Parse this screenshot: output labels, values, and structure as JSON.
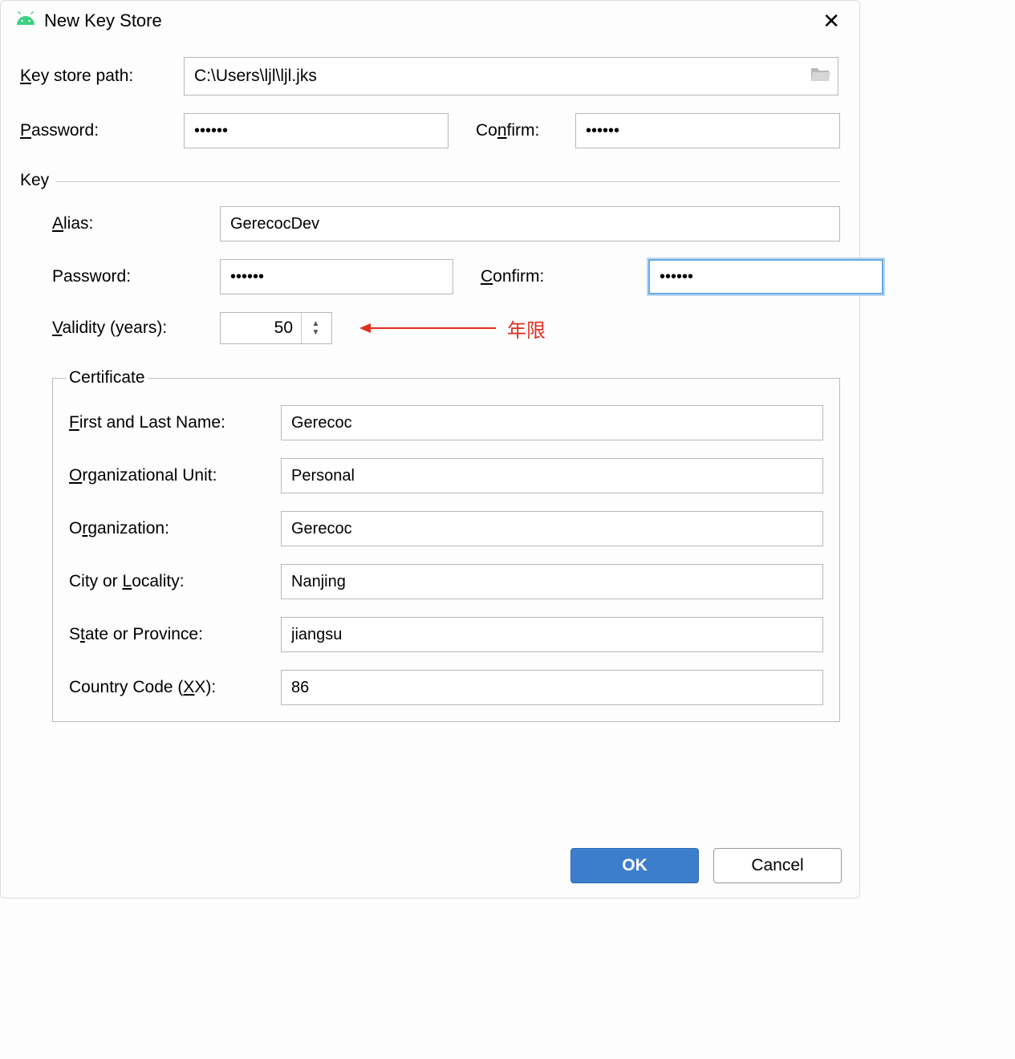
{
  "title": "New Key Store",
  "labels": {
    "keystore_path": "Key store path:",
    "password": "Password:",
    "confirm": "Confirm:",
    "key_section": "Key",
    "alias": "Alias:",
    "key_password": "Password:",
    "key_confirm": "Confirm:",
    "validity": "Validity (years):",
    "cert_legend": "Certificate",
    "first_last": "First and Last Name:",
    "org_unit": "Organizational Unit:",
    "org": "Organization:",
    "city": "City or Locality:",
    "state": "State or Province:",
    "country": "Country Code (XX):"
  },
  "values": {
    "keystore_path": "C:\\Users\\ljl\\ljl.jks",
    "password": "••••••",
    "confirm": "••••••",
    "alias": "GerecocDev",
    "key_password": "••••••",
    "key_confirm": "••••••",
    "validity": "50",
    "first_last": "Gerecoc",
    "org_unit": "Personal",
    "org": "Gerecoc",
    "city": "Nanjing",
    "state": "jiangsu",
    "country": "86"
  },
  "annotation": "年限",
  "buttons": {
    "ok": "OK",
    "cancel": "Cancel"
  }
}
